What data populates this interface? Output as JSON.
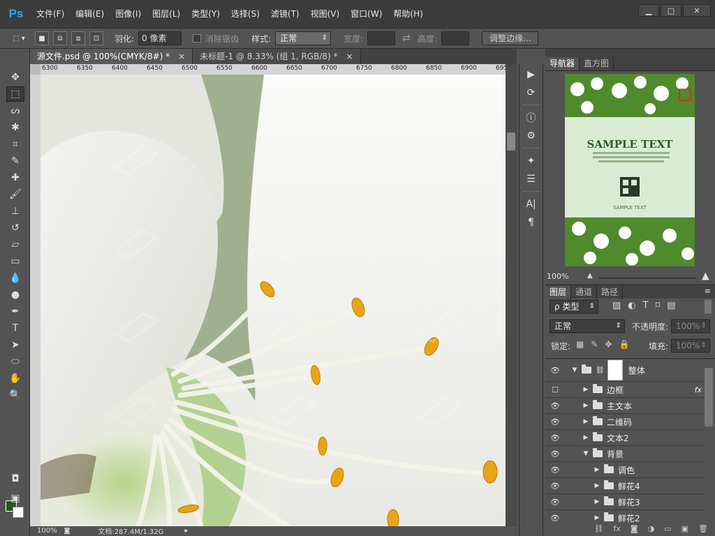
{
  "app": {
    "logo": "Ps"
  },
  "menu": [
    "文件(F)",
    "编辑(E)",
    "图像(I)",
    "图层(L)",
    "类型(Y)",
    "选择(S)",
    "滤镜(T)",
    "视图(V)",
    "窗口(W)",
    "帮助(H)"
  ],
  "window_controls": {
    "min": "▁",
    "max": "□",
    "close": "✕"
  },
  "options": {
    "feather_label": "羽化:",
    "feather_value": "0 像素",
    "antialias_label": "消除锯齿",
    "style_label": "样式:",
    "style_value": "正常",
    "width_label": "宽度:",
    "height_label": "高度:",
    "refine_edge": "调整边缘..."
  },
  "tabs": [
    {
      "label": "源文件.psd @ 100%(CMYK/8#) *",
      "close": "×"
    },
    {
      "label": "未标题-1 @ 8.33% (组 1, RGB/8) *",
      "close": "×"
    }
  ],
  "ruler_ticks": [
    "6300",
    "6350",
    "6400",
    "6450",
    "6500",
    "6550",
    "6600",
    "6650",
    "6700",
    "6750",
    "6800",
    "6850",
    "6900",
    "695"
  ],
  "status": {
    "zoom": "100%",
    "doc": "文档:287.4M/1.32G"
  },
  "navigator": {
    "tabs": [
      "导航器",
      "直方图"
    ],
    "preview_title": "SAMPLE TEXT",
    "preview_sub": "SAMPLE TEXT",
    "zoom": "100%"
  },
  "layers_panel": {
    "tabs": [
      "图层",
      "通道",
      "路径"
    ],
    "filter_label": "ρ 类型",
    "blend_mode": "正常",
    "opacity_label": "不透明度:",
    "opacity_value": "100%",
    "lock_label": "锁定:",
    "fill_label": "填充:",
    "fill_value": "100%",
    "layers": [
      {
        "name": "整体",
        "visible": true,
        "expanded": true,
        "indent": 0,
        "mask": true
      },
      {
        "name": "边框",
        "visible": false,
        "expanded": false,
        "indent": 1,
        "fx": "fx"
      },
      {
        "name": "主文本",
        "visible": true,
        "expanded": false,
        "indent": 1
      },
      {
        "name": "二维码",
        "visible": true,
        "expanded": false,
        "indent": 1
      },
      {
        "name": "文本2",
        "visible": true,
        "expanded": false,
        "indent": 1
      },
      {
        "name": "背景",
        "visible": true,
        "expanded": true,
        "indent": 1
      },
      {
        "name": "调色",
        "visible": true,
        "expanded": false,
        "indent": 2
      },
      {
        "name": "鲜花4",
        "visible": true,
        "expanded": false,
        "indent": 2
      },
      {
        "name": "鲜花3",
        "visible": true,
        "expanded": false,
        "indent": 2
      },
      {
        "name": "鲜花2",
        "visible": true,
        "expanded": false,
        "indent": 2
      }
    ]
  },
  "colors": {
    "foreground": "#1e5a14",
    "background": "#ffffff",
    "accent": "#31a8ff"
  }
}
